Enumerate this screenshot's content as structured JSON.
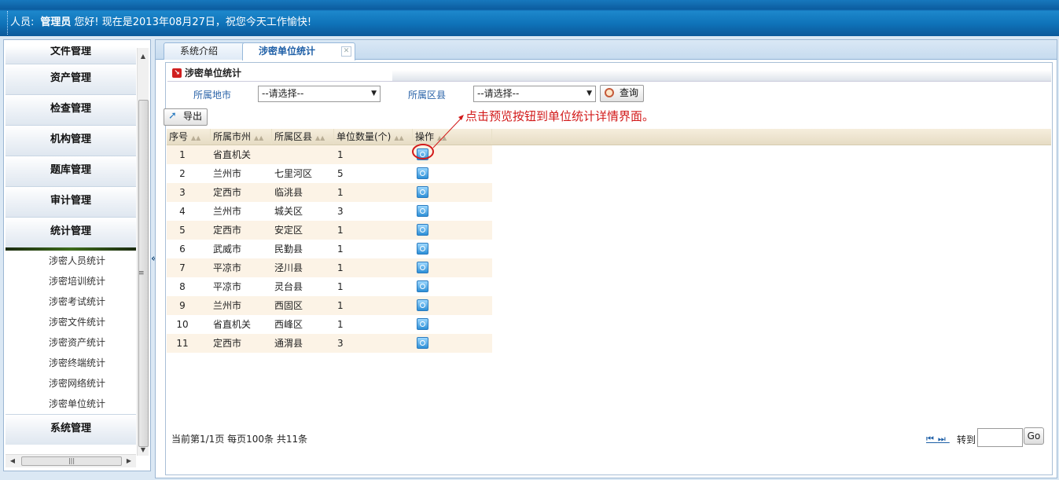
{
  "header": {
    "greeting_prefix": "人员:",
    "user": "管理员",
    "greeting_suffix": "您好!  现在是2013年08月27日，祝您今天工作愉快!"
  },
  "sidebar": {
    "menus": [
      {
        "label": "文件管理"
      },
      {
        "label": "资产管理"
      },
      {
        "label": "检查管理"
      },
      {
        "label": "机构管理"
      },
      {
        "label": "题库管理"
      },
      {
        "label": "审计管理"
      },
      {
        "label": "统计管理"
      }
    ],
    "submenu": [
      "涉密人员统计",
      "涉密培训统计",
      "涉密考试统计",
      "涉密文件统计",
      "涉密资产统计",
      "涉密终端统计",
      "涉密网络统计",
      "涉密单位统计"
    ],
    "last_menu": "系统管理",
    "collapse_glyph": "«"
  },
  "tabs": [
    {
      "label": "系统介绍"
    },
    {
      "label": "涉密单位统计"
    }
  ],
  "panel": {
    "title": "涉密单位统计",
    "city_label": "所属地市",
    "city_value": "--请选择--",
    "county_label": "所属区县",
    "county_value": "--请选择--",
    "query_label": "查询",
    "export_label": "导出"
  },
  "annotation": "点击预览按钮到单位统计详情界面。",
  "grid": {
    "columns": [
      "序号",
      "所属市州",
      "所属区县",
      "单位数量(个)",
      "操作"
    ],
    "rows": [
      [
        "1",
        "省直机关",
        "",
        "1"
      ],
      [
        "2",
        "兰州市",
        "七里河区",
        "5"
      ],
      [
        "3",
        "定西市",
        "临洮县",
        "1"
      ],
      [
        "4",
        "兰州市",
        "城关区",
        "3"
      ],
      [
        "5",
        "定西市",
        "安定区",
        "1"
      ],
      [
        "6",
        "武威市",
        "民勤县",
        "1"
      ],
      [
        "7",
        "平凉市",
        "泾川县",
        "1"
      ],
      [
        "8",
        "平凉市",
        "灵台县",
        "1"
      ],
      [
        "9",
        "兰州市",
        "西固区",
        "1"
      ],
      [
        "10",
        "省直机关",
        "西峰区",
        "1"
      ],
      [
        "11",
        "定西市",
        "通渭县",
        "3"
      ]
    ]
  },
  "pager": {
    "info": "当前第1/1页  每页100条  共11条",
    "goto_label": "转到",
    "go_label": "Go",
    "goto_value": ""
  },
  "colors": {
    "accent": "#0b5fa3",
    "row_alt": "#fcf3e6",
    "annotation": "#d21a1a"
  }
}
